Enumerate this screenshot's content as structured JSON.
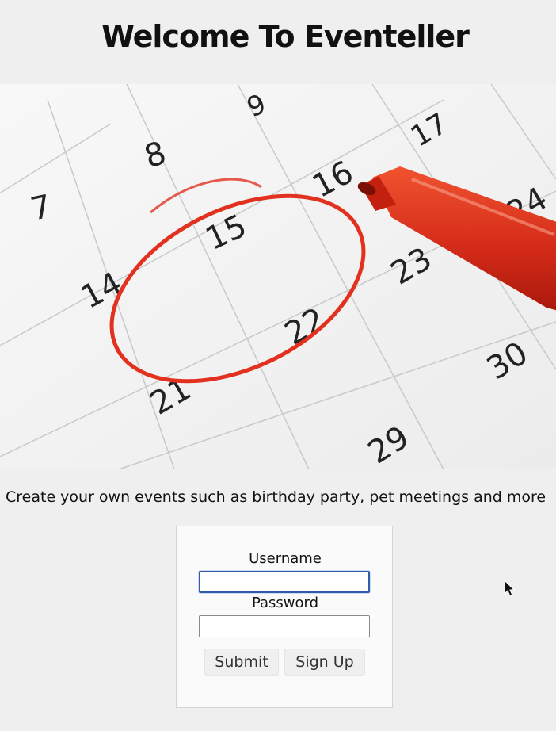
{
  "header": {
    "title": "Welcome To Eventeller"
  },
  "hero": {
    "description": "calendar",
    "dates": [
      "7",
      "8",
      "9",
      "14",
      "15",
      "16",
      "17",
      "21",
      "22",
      "23",
      "24",
      "29",
      "30"
    ]
  },
  "tagline": "Create your own events such as birthday party, pet meetings and more",
  "login": {
    "username_label": "Username",
    "username_value": "",
    "password_label": "Password",
    "password_value": "",
    "submit_label": "Submit",
    "signup_label": "Sign Up"
  },
  "colors": {
    "background": "#efefef",
    "marker_red": "#e2321f",
    "focus_blue": "#2f5da8"
  }
}
